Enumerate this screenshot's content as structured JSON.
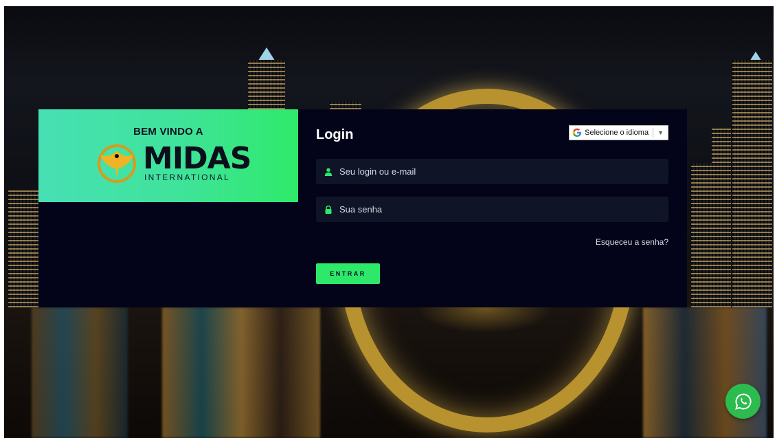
{
  "brand": {
    "welcome": "BEM VINDO A",
    "logo_word": "MIDAS",
    "logo_sub": "INTERNATIONAL"
  },
  "login": {
    "title": "Login",
    "language_select": {
      "label": "Selecione o idioma",
      "icon": "google-icon"
    },
    "username": {
      "placeholder": "Seu login ou e-mail",
      "icon": "user-icon"
    },
    "password": {
      "placeholder": "Sua senha",
      "icon": "lock-icon"
    },
    "forgot_link": "Esqueceu a senha?",
    "submit_label": "ENTRAR"
  },
  "floating": {
    "whatsapp_icon": "whatsapp-icon"
  },
  "colors": {
    "accent_green": "#2ee86a",
    "panel_dark": "#03041a",
    "field_bg": "#0f1427"
  }
}
